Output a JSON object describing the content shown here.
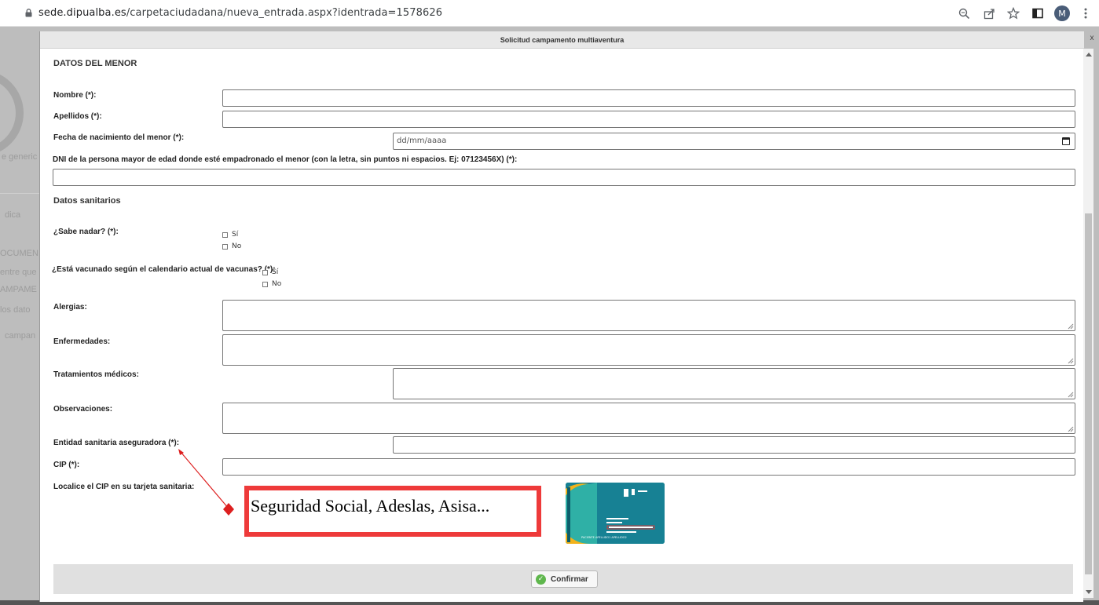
{
  "browser": {
    "url_host": "sede.dipualba.es",
    "url_path": "/carpetaciudadana/nueva_entrada.aspx?identrada=1578626",
    "avatar_initial": "M",
    "icons": [
      "zoom-icon",
      "share-icon",
      "bookmark-star-icon",
      "sidepanel-icon",
      "menu-kebab-icon"
    ]
  },
  "background_page": {
    "snippets": [
      "e generic",
      "dica",
      "OCUMEN",
      "entre que",
      "AMPAME",
      "los dato",
      "campan"
    ]
  },
  "modal": {
    "title": "Solicitud campamento multiaventura",
    "close_label": "x"
  },
  "form": {
    "section_menor": "DATOS DEL MENOR",
    "nombre_label": "Nombre (*):",
    "nombre_value": "",
    "apellidos_label": "Apellidos (*):",
    "apellidos_value": "",
    "fecha_label": "Fecha de nacimiento del menor (*):",
    "fecha_placeholder": "dd/mm/aaaa",
    "dni_label": "DNI de la persona mayor de edad donde esté empadronado el menor (con la letra, sin puntos ni espacios. Ej: 07123456X) (*):",
    "dni_value": "",
    "section_sanitarios": "Datos sanitarios",
    "nadar_label": "¿Sabe nadar? (*):",
    "nadar_si": "Sí",
    "nadar_no": "No",
    "vacunado_label": "¿Está vacunado según el calendario actual de vacunas? (*):",
    "vacunado_si": "Sí",
    "vacunado_no": "No",
    "alergias_label": "Alergias:",
    "enfermedades_label": "Enfermedades:",
    "tratamientos_label": "Tratamientos médicos:",
    "observaciones_label": "Observaciones:",
    "entidad_label": "Entidad sanitaria aseguradora (*):",
    "cip_label": "CIP (*):",
    "localice_label": "Localice el CIP en su tarjeta sanitaria:"
  },
  "callout": {
    "text": "Seguridad Social, Adeslas, Asisa..."
  },
  "card_image": {
    "patient_text": "PACIENTE APELLIDO1 APELLIDO2",
    "highlight_color": "#d63a3a"
  },
  "footer": {
    "confirm_label": "Confirmar"
  },
  "colors": {
    "callout_border": "#ee3a3a",
    "arrow": "#dd1f1f",
    "confirm_icon": "#5fb74d"
  }
}
